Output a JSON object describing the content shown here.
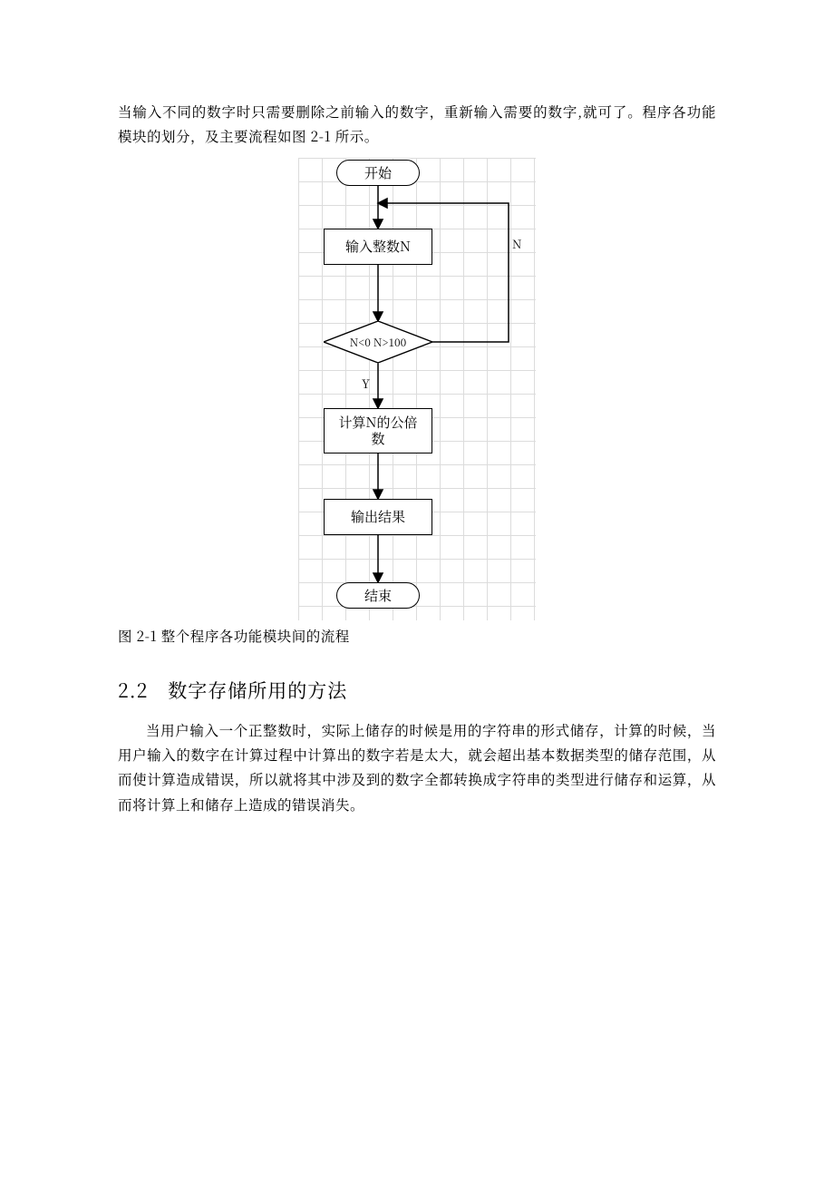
{
  "intro_para": "当输入不同的数字时只需要删除之前输入的数字，重新输入需要的数字,就可了。程序各功能模块的划分，及主要流程如图 2-1 所示。",
  "flowchart": {
    "start": "开始",
    "input": "输入整数N",
    "decision": "N<0  N>100",
    "branch_no": "N",
    "branch_yes": "Y",
    "compute_line1": "计算N的公倍",
    "compute_line2": "数",
    "output": "输出结果",
    "end": "结束"
  },
  "caption": "图 2-1 整个程序各功能模块间的流程",
  "section_title": "2.2　数字存储所用的方法",
  "body_para": "当用户输入一个正整数时，实际上储存的时候是用的字符串的形式储存，计算的时候，当用户输入的数字在计算过程中计算出的数字若是太大，就会超出基本数据类型的储存范围，从而使计算造成错误，所以就将其中涉及到的数字全都转换成字符串的类型进行储存和运算，从而将计算上和储存上造成的错误消失。"
}
